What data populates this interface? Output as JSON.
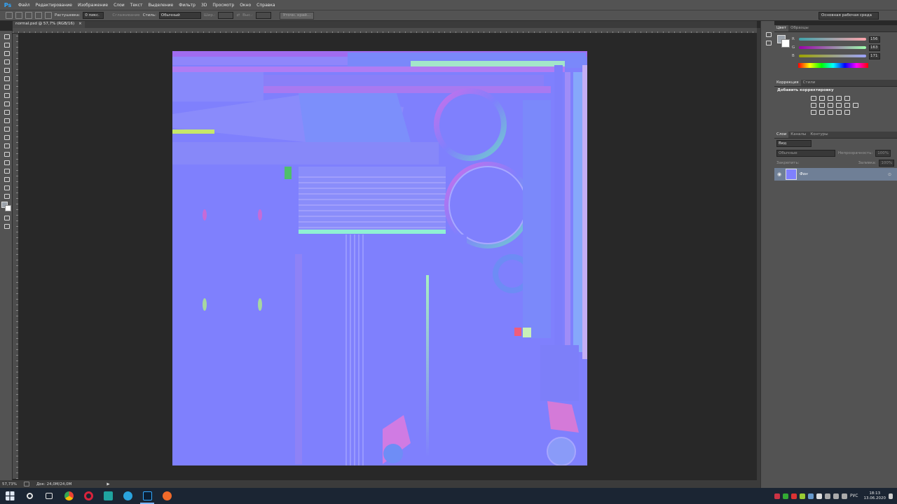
{
  "app": {
    "logo": "Ps"
  },
  "menu": [
    "Файл",
    "Редактирование",
    "Изображение",
    "Слои",
    "Текст",
    "Выделение",
    "Фильтр",
    "3D",
    "Просмотр",
    "Окно",
    "Справка"
  ],
  "options": {
    "feather_label": "Растушевка:",
    "feather_value": "0 пикс.",
    "antialias_label": "Сглаживание",
    "style_label": "Стиль:",
    "style_value": "Обычный",
    "width_label": "Шир.:",
    "height_label": "Выс.:",
    "refine_edge": "Уточн. край...",
    "workspace": "Основная рабочая среда"
  },
  "document": {
    "tab_title": "normal.psd @ 57,7% (RGB/16)",
    "close_glyph": "×"
  },
  "status": {
    "zoom": "57,73%",
    "doc_size": "Док: 24,0M/24,0M",
    "arrow": "▶"
  },
  "panels": {
    "color_tabs": [
      "Цвет",
      "Образцы"
    ],
    "color": {
      "r_label": "R",
      "r_value": "156",
      "g_label": "G",
      "g_value": "163",
      "b_label": "B",
      "b_value": "171",
      "r_track": "#c56a7a",
      "g_track": "#7fc86a",
      "b_track": "#7a8dd8"
    },
    "adjust_tabs": [
      "Коррекция",
      "Стили"
    ],
    "adjust_title": "Добавить корректировку",
    "layer_tabs": [
      "Слои",
      "Каналы",
      "Контуры"
    ],
    "layers": {
      "kind_filter": "Вид",
      "blend_mode": "Обычные",
      "opacity_label": "Непрозрачность:",
      "opacity_value": "100%",
      "lock_label": "Закрепить:",
      "fill_label": "Заливка:",
      "fill_value": "100%",
      "layer_name": "Фон"
    }
  },
  "taskbar": {
    "lang": "РУС",
    "time": "18:13",
    "date": "13.06.2020",
    "apps": [
      "windows-icon",
      "search-icon",
      "task-view-icon",
      "chrome-icon",
      "opera-icon",
      "3dsmax-icon",
      "telegram-icon",
      "photoshop-icon",
      "substance-icon"
    ]
  },
  "colors": {
    "normal_map_base": "#7f80fd",
    "accent": "#31a8ff"
  }
}
